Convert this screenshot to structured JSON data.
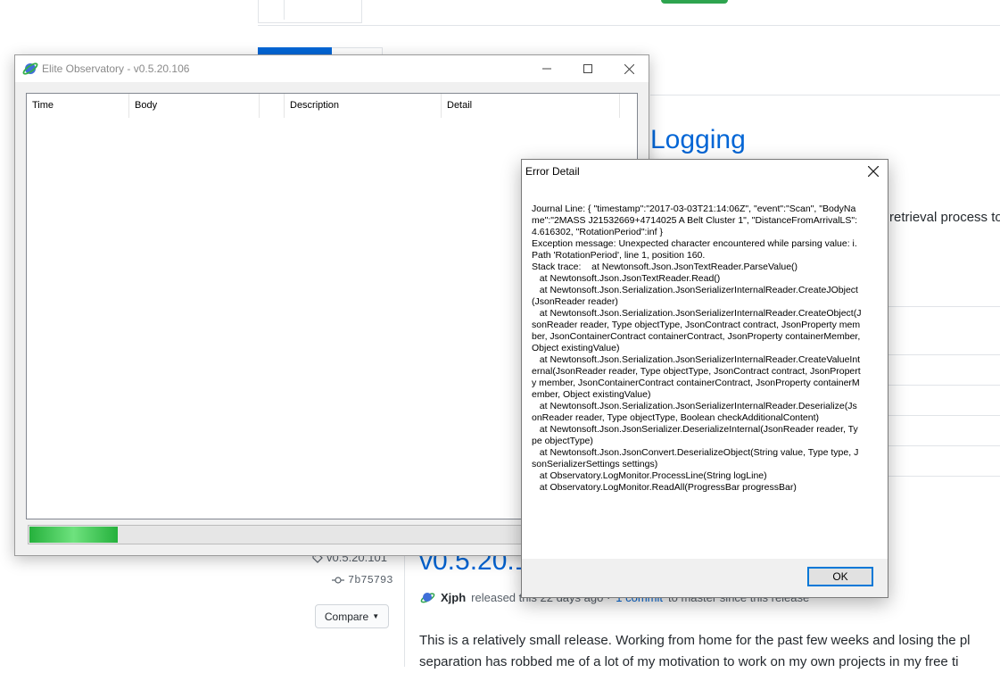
{
  "background_page": {
    "release_heading": "Logging",
    "retrieval_text": "retrieval process to",
    "tag": "v0.5.20.101",
    "commit": "7b75793",
    "compare_label": "Compare",
    "version_title": "v0.5.20.1",
    "release_author": "Xjph",
    "release_meta_before": "released this 22 days ago ·",
    "release_commits_link": "1 commit",
    "release_meta_after": "to master since this release",
    "description_line1": "This is a relatively small release. Working from home for the past few weeks and losing the pl",
    "description_line2": "separation has robbed me of a lot of my motivation to work on my own projects in my free ti"
  },
  "app_window": {
    "title": "Elite Observatory - v0.5.20.106",
    "columns": [
      "Time",
      "Body",
      "",
      "Description",
      "Detail"
    ],
    "progress": 0.18
  },
  "error_dialog": {
    "title": "Error Detail",
    "body": "Journal Line: { \"timestamp\":\"2017-03-03T21:14:06Z\", \"event\":\"Scan\", \"BodyName\":\"2MASS J21532669+4714025 A Belt Cluster 1\", \"DistanceFromArrivalLS\":4.616302, \"RotationPeriod\":inf }\nException message: Unexpected character encountered while parsing value: i. Path 'RotationPeriod', line 1, position 160.\nStack trace:    at Newtonsoft.Json.JsonTextReader.ParseValue()\n   at Newtonsoft.Json.JsonTextReader.Read()\n   at Newtonsoft.Json.Serialization.JsonSerializerInternalReader.CreateJObject(JsonReader reader)\n   at Newtonsoft.Json.Serialization.JsonSerializerInternalReader.CreateObject(JsonReader reader, Type objectType, JsonContract contract, JsonProperty member, JsonContainerContract containerContract, JsonProperty containerMember, Object existingValue)\n   at Newtonsoft.Json.Serialization.JsonSerializerInternalReader.CreateValueInternal(JsonReader reader, Type objectType, JsonContract contract, JsonProperty member, JsonContainerContract containerContract, JsonProperty containerMember, Object existingValue)\n   at Newtonsoft.Json.Serialization.JsonSerializerInternalReader.Deserialize(JsonReader reader, Type objectType, Boolean checkAdditionalContent)\n   at Newtonsoft.Json.JsonSerializer.DeserializeInternal(JsonReader reader, Type objectType)\n   at Newtonsoft.Json.JsonConvert.DeserializeObject(String value, Type type, JsonSerializerSettings settings)\n   at Observatory.LogMonitor.ProcessLine(String logLine)\n   at Observatory.LogMonitor.ReadAll(ProgressBar progressBar)",
    "ok_label": "OK"
  }
}
